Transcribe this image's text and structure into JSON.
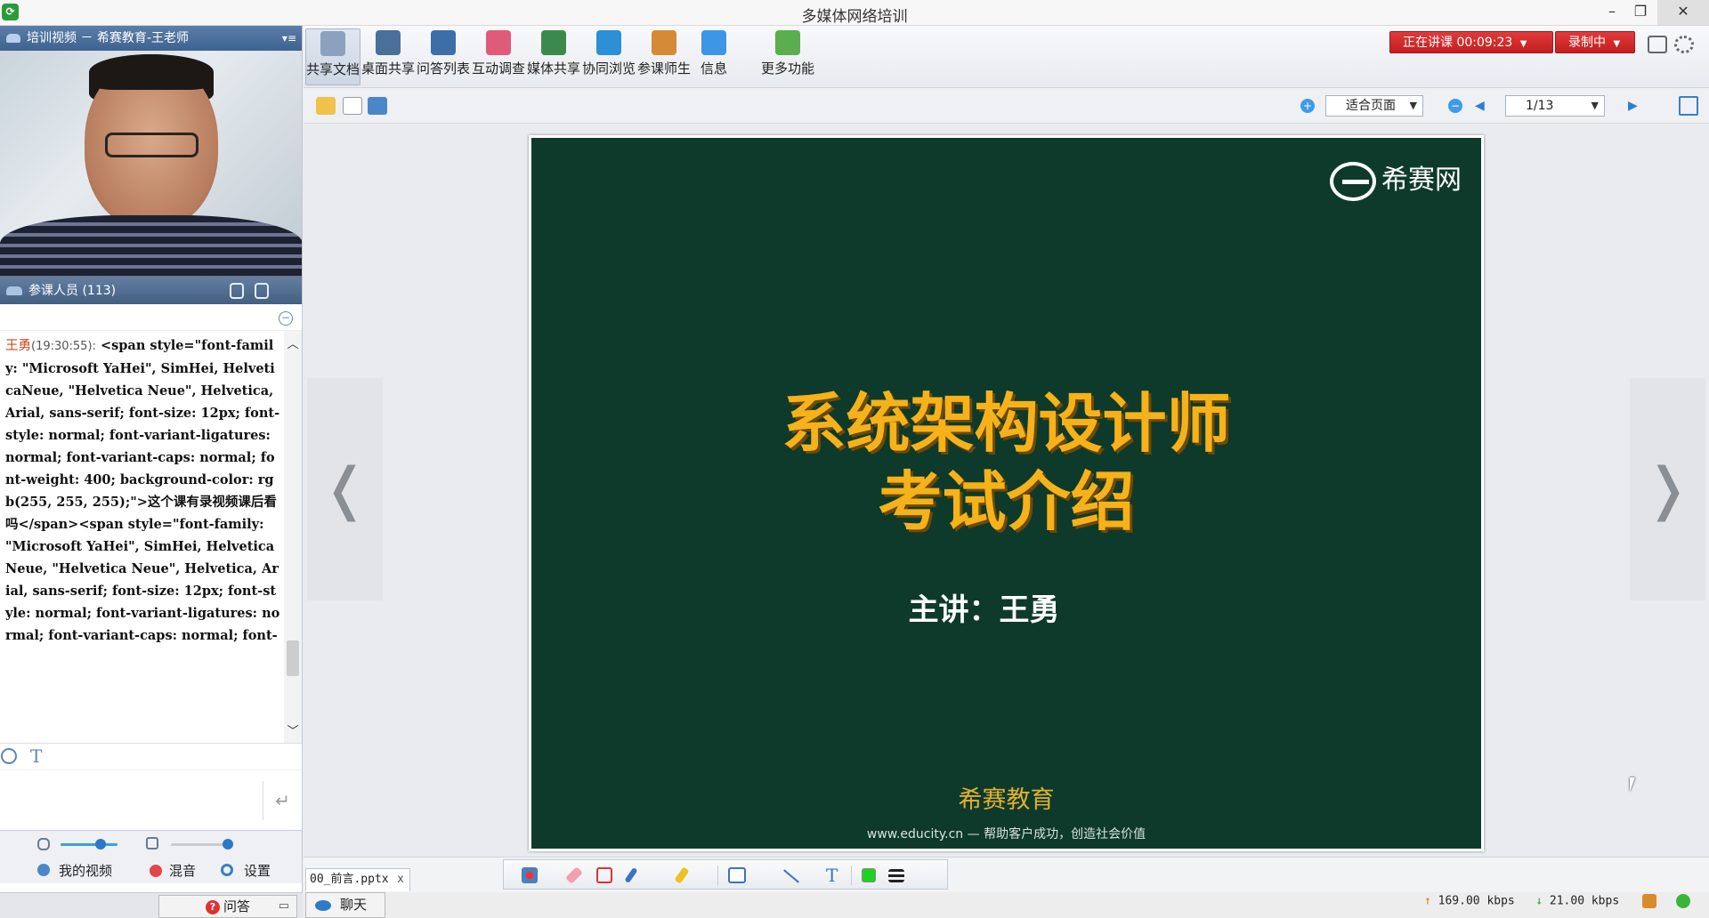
{
  "window": {
    "title": "多媒体网络培训",
    "minimize": "–",
    "restore": "❐",
    "close": "✕"
  },
  "video_panel": {
    "title": "培训视频 － 希赛教育-王老师",
    "menu_glyph": "▾≡"
  },
  "participants": {
    "label": "参课人员 (113)"
  },
  "chat": {
    "sender": "王勇",
    "time": "(19:30:55):",
    "text": " <span style=\"font-family: \"Microsoft YaHei\", SimHei, HelveticaNeue, \"Helvetica Neue\", Helvetica, Arial, sans-serif; font-size: 12px; font-style: normal; font-variant-ligatures: normal; font-variant-caps: normal; font-weight: 400; background-color: rgb(255, 255, 255);\">这个课有录视频课后看吗</span><span style=\"font-family: \"Microsoft YaHei\", SimHei, HelveticaNeue, \"Helvetica Neue\", Helvetica, Arial, sans-serif; font-size: 12px; font-style: normal; font-variant-ligatures: normal; font-variant-caps: normal; font-",
    "scroll_up": "︿",
    "scroll_down": "﹀",
    "send_glyph": "↵",
    "text_tool": "T"
  },
  "av_controls": {
    "mic_level": 0.7,
    "speaker_level": 1.0,
    "my_video": "我的视频",
    "mix": "混音",
    "settings": "设置"
  },
  "bottom_tabs": {
    "qa": "问答",
    "chat": "聊天"
  },
  "toolbar": {
    "items": [
      {
        "label": "共享文档",
        "icon": "document-icon",
        "color": "#8aa2c0"
      },
      {
        "label": "桌面共享",
        "icon": "desktop-share-icon",
        "color": "#4a6f98"
      },
      {
        "label": "问答列表",
        "icon": "qa-list-icon",
        "color": "#3d6ea8"
      },
      {
        "label": "互动调查",
        "icon": "survey-chart-icon",
        "color": "#e05a7a"
      },
      {
        "label": "媒体共享",
        "icon": "media-share-icon",
        "color": "#3c8a4b"
      },
      {
        "label": "协同浏览",
        "icon": "browser-icon",
        "color": "#2d8fd6"
      },
      {
        "label": "参课师生",
        "icon": "people-icon",
        "color": "#d48a36"
      },
      {
        "label": "信息",
        "icon": "info-icon",
        "color": "#3d95e6"
      },
      {
        "label": "更多功能",
        "icon": "more-apps-icon",
        "color": "#5aae4e"
      }
    ],
    "live_status": "正在讲课 00:09:23",
    "recording": "录制中",
    "dropdown_glyph": "▼"
  },
  "doc_toolbar": {
    "zoom_mode": "适合页面",
    "page": "1/13",
    "dropdown_glyph": "▼",
    "prev_glyph": "◀",
    "next_glyph": "▶"
  },
  "slide": {
    "logo_text": "希赛网",
    "title_line1": "系统架构设计师",
    "title_line2": "考试介绍",
    "speaker": "主讲：王勇",
    "org": "希赛教育",
    "footer": "www.educity.cn — 帮助客户成功，创造社会价值",
    "prev_arrow": "❬",
    "next_arrow": "❭"
  },
  "doc_tab": {
    "filename": "00_前言.pptx",
    "close": "x"
  },
  "status": {
    "upload": "169.00 kbps",
    "download": "21.00 kbps",
    "up_glyph": "↑",
    "down_glyph": "↓"
  }
}
